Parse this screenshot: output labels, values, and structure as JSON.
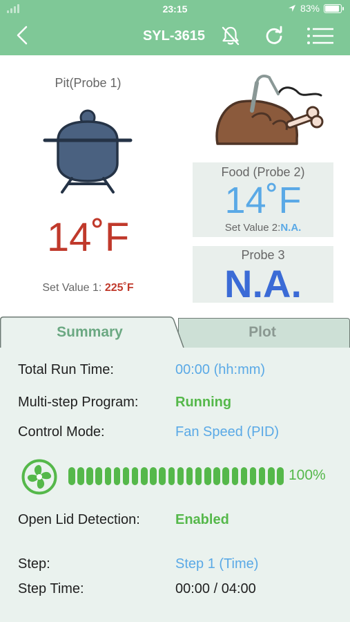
{
  "status_bar": {
    "time": "23:15",
    "battery": "83%"
  },
  "header": {
    "title": "SYL-3615",
    "back_icon": "chevron-left-icon",
    "alarm_icon": "bell-off-icon",
    "refresh_icon": "refresh-icon",
    "menu_icon": "menu-list-icon",
    "background": "#7fc897"
  },
  "pit": {
    "label": "Pit(Probe 1)",
    "temperature": "14˚F",
    "set_value_label": "Set Value 1:",
    "set_value": "225˚F",
    "color": "#c0392b"
  },
  "food": {
    "label": "Food (Probe 2)",
    "temperature": "14˚F",
    "set_value_label": "Set Value 2:",
    "set_value": "N.A.",
    "color": "#5aa9e6"
  },
  "probe3": {
    "label": "Probe 3",
    "value": "N.A.",
    "color": "#3b6bd6"
  },
  "tabs": {
    "summary": "Summary",
    "plot": "Plot",
    "active": "Summary"
  },
  "summary": {
    "total_run_time_label": "Total Run Time:",
    "total_run_time": "00:00 (hh:mm)",
    "program_label": "Multi-step Program:",
    "program_status": "Running",
    "control_mode_label": "Control Mode:",
    "control_mode": "Fan Speed (PID)",
    "fan_level_percent": 100,
    "fan_level_text": "100%",
    "lid_detection_label": "Open Lid Detection:",
    "lid_detection": "Enabled",
    "step_label": "Step:",
    "step": "Step 1 (Time)",
    "step_time_label": "Step Time:",
    "step_time": "00:00 / 04:00"
  }
}
